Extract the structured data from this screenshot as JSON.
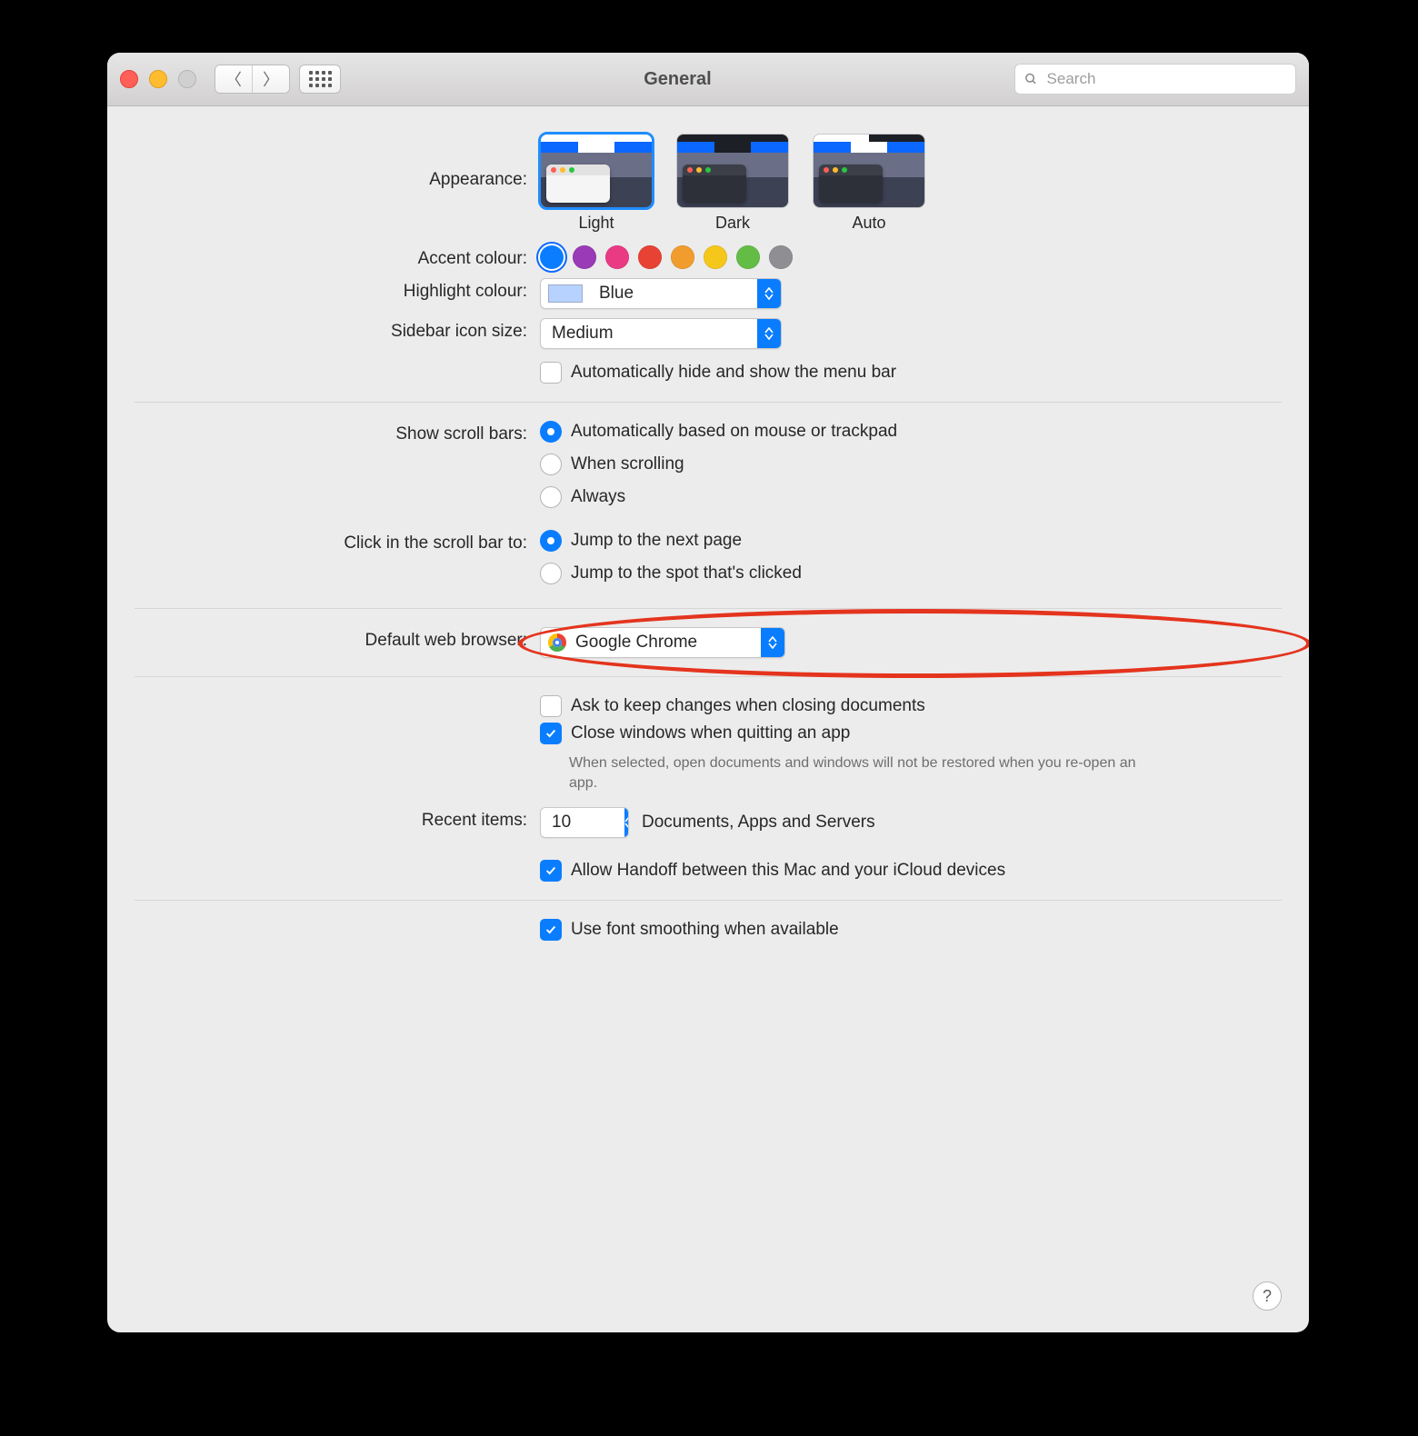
{
  "title": "General",
  "search_placeholder": "Search",
  "appearance": {
    "label": "Appearance:",
    "options": [
      "Light",
      "Dark",
      "Auto"
    ],
    "selected": "Light"
  },
  "accent": {
    "label": "Accent colour:",
    "colors": [
      "#0a7dff",
      "#9a3ab7",
      "#ea3a84",
      "#e74234",
      "#f19d2d",
      "#f6c71b",
      "#63bd45",
      "#8e8e93"
    ],
    "selected": 0
  },
  "highlight": {
    "label": "Highlight colour:",
    "value": "Blue"
  },
  "sidebar_icon": {
    "label": "Sidebar icon size:",
    "value": "Medium"
  },
  "auto_hide_menu": {
    "label": "Automatically hide and show the menu bar",
    "checked": false
  },
  "scroll_bars": {
    "label": "Show scroll bars:",
    "options": [
      "Automatically based on mouse or trackpad",
      "When scrolling",
      "Always"
    ],
    "selected": 0
  },
  "scroll_click": {
    "label": "Click in the scroll bar to:",
    "options": [
      "Jump to the next page",
      "Jump to the spot that's clicked"
    ],
    "selected": 0
  },
  "default_browser": {
    "label": "Default web browser:",
    "value": "Google Chrome"
  },
  "ask_keep": {
    "label": "Ask to keep changes when closing documents",
    "checked": false
  },
  "close_windows": {
    "label": "Close windows when quitting an app",
    "checked": true,
    "hint": "When selected, open documents and windows will not be restored when you re-open an app."
  },
  "recent": {
    "label": "Recent items:",
    "value": "10",
    "suffix": "Documents, Apps and Servers"
  },
  "handoff": {
    "label": "Allow Handoff between this Mac and your iCloud devices",
    "checked": true
  },
  "font_smooth": {
    "label": "Use font smoothing when available",
    "checked": true
  }
}
